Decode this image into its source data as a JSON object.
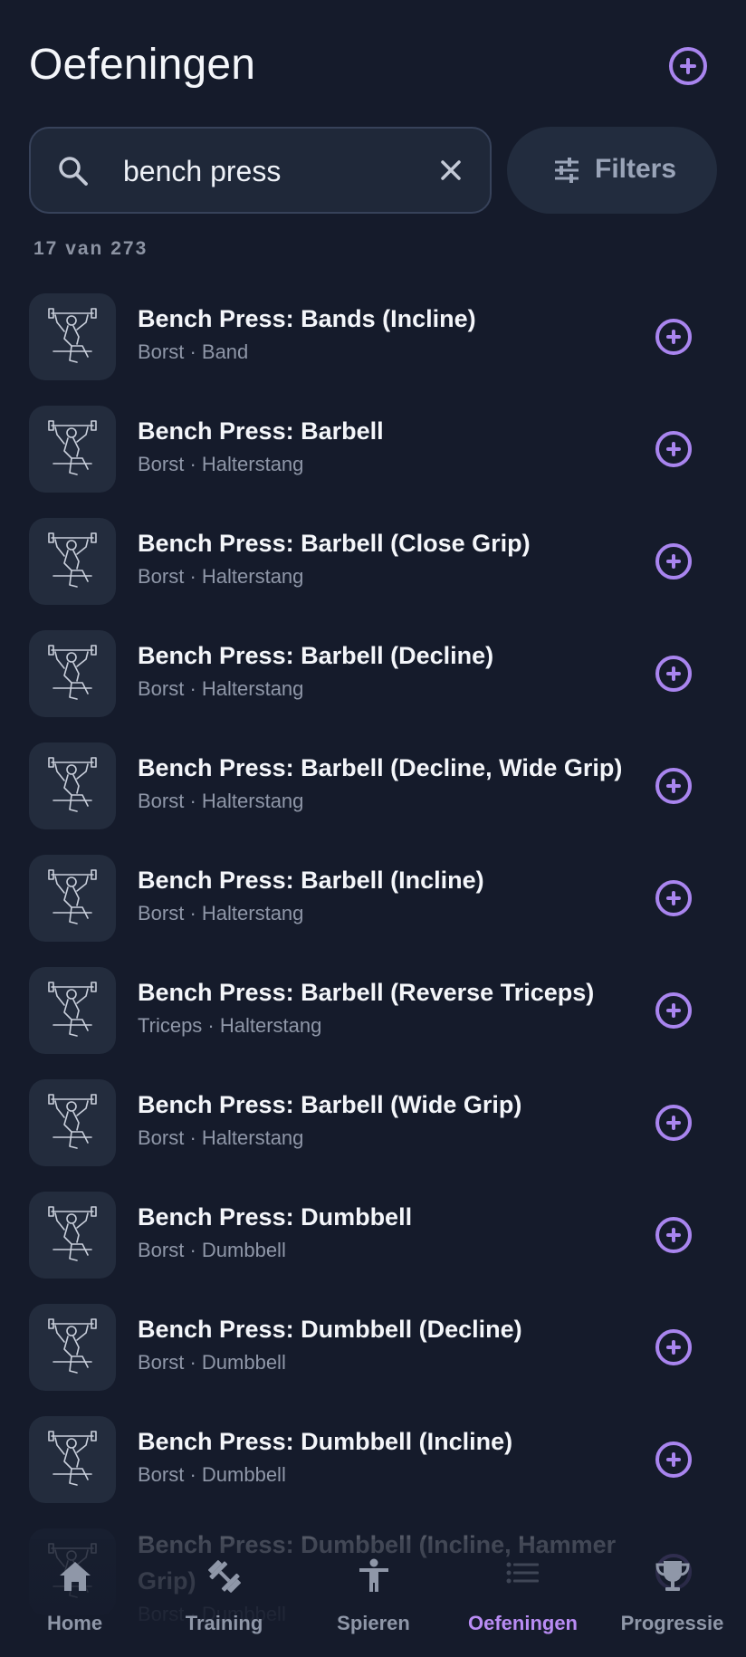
{
  "header": {
    "title": "Oefeningen",
    "add_icon": "plus-circle-icon"
  },
  "search": {
    "value": "bench press",
    "placeholder": "",
    "icon": "search-icon",
    "clear_icon": "close-icon"
  },
  "filters": {
    "label": "Filters",
    "icon": "sliders-icon"
  },
  "result_count": "17 van 273",
  "exercises": [
    {
      "name": "Bench Press: Bands (Incline)",
      "subtitle": "Borst · Band"
    },
    {
      "name": "Bench Press: Barbell",
      "subtitle": "Borst · Halterstang"
    },
    {
      "name": "Bench Press: Barbell (Close Grip)",
      "subtitle": "Borst · Halterstang"
    },
    {
      "name": "Bench Press: Barbell (Decline)",
      "subtitle": "Borst · Halterstang"
    },
    {
      "name": "Bench Press: Barbell (Decline, Wide Grip)",
      "subtitle": "Borst · Halterstang"
    },
    {
      "name": "Bench Press: Barbell (Incline)",
      "subtitle": "Borst · Halterstang"
    },
    {
      "name": "Bench Press: Barbell (Reverse Triceps)",
      "subtitle": "Triceps · Halterstang"
    },
    {
      "name": "Bench Press: Barbell (Wide Grip)",
      "subtitle": "Borst · Halterstang"
    },
    {
      "name": "Bench Press: Dumbbell",
      "subtitle": "Borst · Dumbbell"
    },
    {
      "name": "Bench Press: Dumbbell (Decline)",
      "subtitle": "Borst · Dumbbell"
    },
    {
      "name": "Bench Press: Dumbbell (Incline)",
      "subtitle": "Borst · Dumbbell"
    },
    {
      "name": "Bench Press: Dumbbell (Incline, Hammer Grip)",
      "subtitle": "Borst · Dumbbell"
    }
  ],
  "nav": [
    {
      "label": "Home",
      "icon": "home-icon",
      "active": false
    },
    {
      "label": "Training",
      "icon": "dumbbell-icon",
      "active": false
    },
    {
      "label": "Spieren",
      "icon": "person-icon",
      "active": false
    },
    {
      "label": "Oefeningen",
      "icon": "list-icon",
      "active": true
    },
    {
      "label": "Progressie",
      "icon": "trophy-icon",
      "active": false
    }
  ],
  "colors": {
    "background": "#151b2b",
    "accent": "#a985ef",
    "nav_active": "#b98cf4",
    "muted_text": "#8f97a8"
  }
}
